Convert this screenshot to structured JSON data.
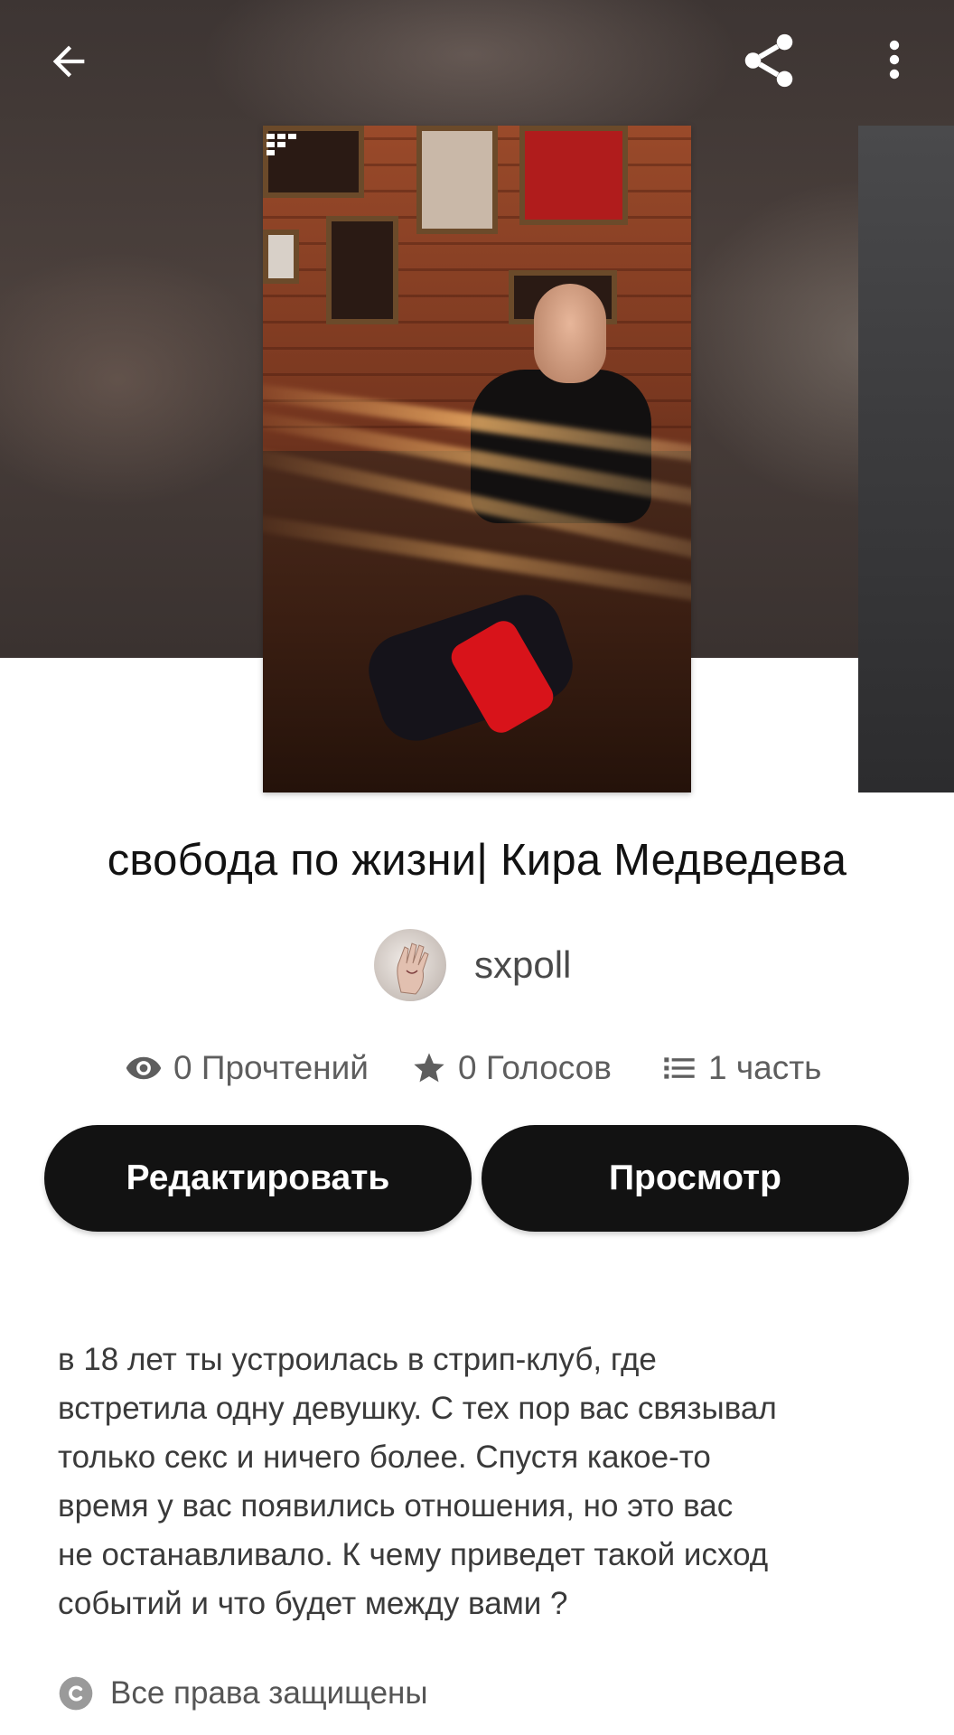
{
  "top_bar": {
    "back_icon": "arrow-left-icon",
    "share_icon": "share-icon",
    "more_icon": "more-vertical-icon"
  },
  "story": {
    "title": "свобода по жизни| Кира Медведева",
    "author": "sxpoll"
  },
  "stats": {
    "reads": "0 Прочтений",
    "votes": "0 Голосов",
    "parts": "1 часть"
  },
  "actions": {
    "edit_label": "Редактировать",
    "view_label": "Просмотр"
  },
  "description": "в 18 лет ты устроилась в стрип-клуб, где\nвстретила одну девушку. С тех пор вас связывал\nтолько секс и ничего более. Спустя какое-то\nвремя у вас появились отношения, но это вас\nне останавливало. К чему приведет такой исход\nсобытий и что будет между вами ?",
  "copyright": "Все права защищены",
  "colors": {
    "button_bg": "#121212",
    "button_text": "#ffffff",
    "title_text": "#121212",
    "meta_text": "#5e5e5e"
  }
}
